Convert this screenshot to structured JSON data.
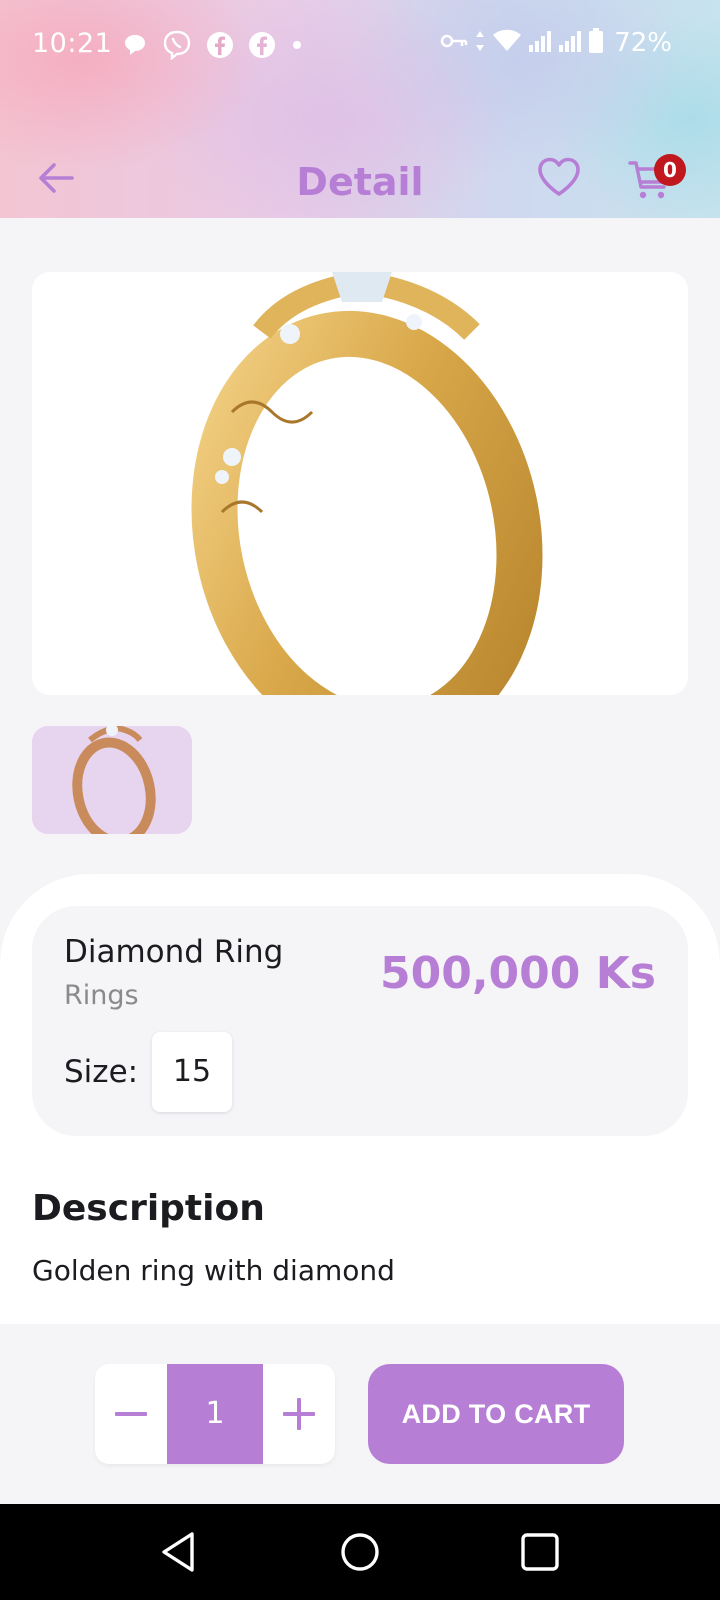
{
  "status_bar": {
    "time": "10:21",
    "battery": "72%",
    "left_icons": [
      "chat-bubble-icon",
      "viber-icon",
      "facebook-icon",
      "facebook-icon",
      "dot-icon"
    ],
    "right_icons": [
      "key-icon",
      "data-arrows-icon",
      "wifi-icon",
      "signal-icon",
      "signal-icon",
      "battery-icon"
    ]
  },
  "app_bar": {
    "title": "Detail",
    "cart_count": "0",
    "icons": [
      "back-arrow-icon",
      "heart-icon",
      "cart-icon"
    ]
  },
  "product": {
    "name": "Diamond Ring",
    "category": "Rings",
    "price": "500,000 Ks",
    "size_label": "Size:",
    "size_value": "15"
  },
  "description": {
    "title": "Description",
    "text": "Golden ring with diamond"
  },
  "actions": {
    "quantity": "1",
    "add_to_cart": "ADD TO CART"
  },
  "colors": {
    "accent": "#b77ed6",
    "badge": "#c0181e",
    "background": "#f5f4f7"
  },
  "nav": {
    "icons": [
      "back-triangle-icon",
      "home-circle-icon",
      "recents-square-icon"
    ]
  }
}
